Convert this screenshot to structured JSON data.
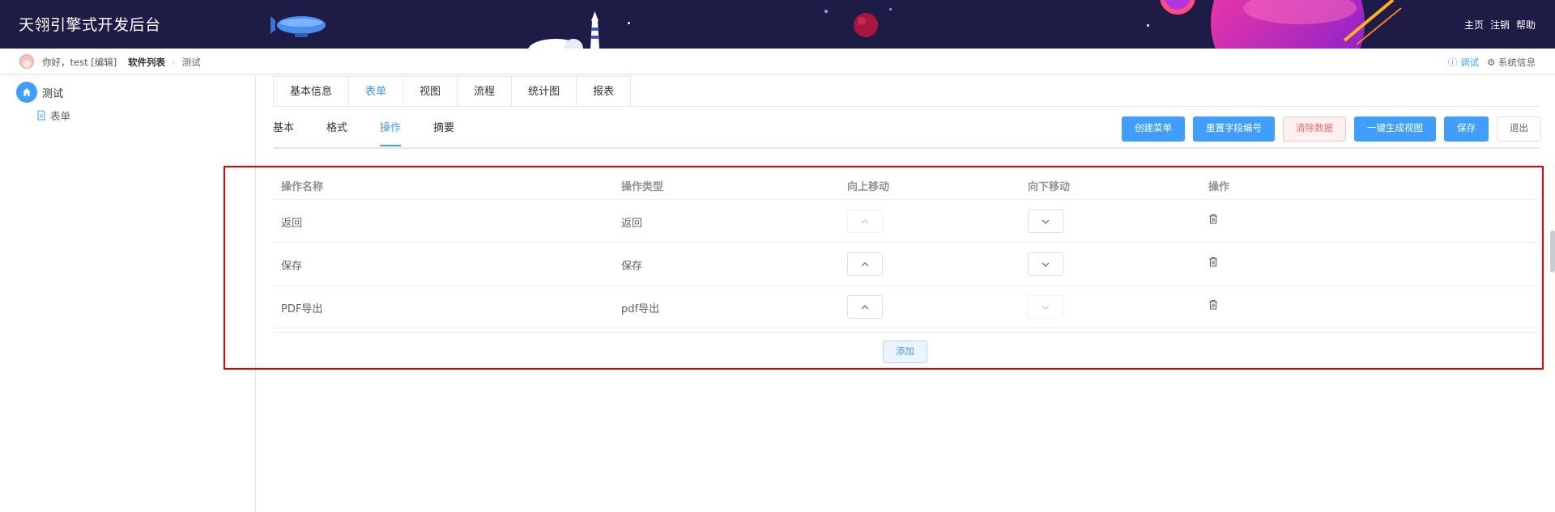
{
  "header": {
    "app_title": "天翎引擎式开发后台",
    "links": [
      "主页",
      "注销",
      "帮助"
    ]
  },
  "crumbbar": {
    "greeting": "你好，test [编辑]",
    "crumbs": [
      "软件列表",
      "测试"
    ],
    "debug_label": "调试",
    "sysinfo_label": "系统信息"
  },
  "sidebar": {
    "root_label": "测试",
    "child_label": "表单"
  },
  "tabs": [
    "基本信息",
    "表单",
    "视图",
    "流程",
    "统计图",
    "报表"
  ],
  "subtabs": [
    "基本",
    "格式",
    "操作",
    "摘要"
  ],
  "toolbar": {
    "create_menu": "创建菜单",
    "reset_field_no": "重置字段编号",
    "clear_data": "清除数据",
    "gen_view": "一键生成视图",
    "save": "保存",
    "exit": "退出"
  },
  "table": {
    "headers": [
      "操作名称",
      "操作类型",
      "向上移动",
      "向下移动",
      "操作"
    ],
    "rows": [
      {
        "name": "返回",
        "type": "返回"
      },
      {
        "name": "保存",
        "type": "保存"
      },
      {
        "name": "PDF导出",
        "type": "pdf导出"
      }
    ],
    "add_label": "添加"
  },
  "colors": {
    "topbar": "#1e1b47",
    "accent": "#409eff",
    "danger": "#f56c6c",
    "highlight": "#e60000"
  }
}
